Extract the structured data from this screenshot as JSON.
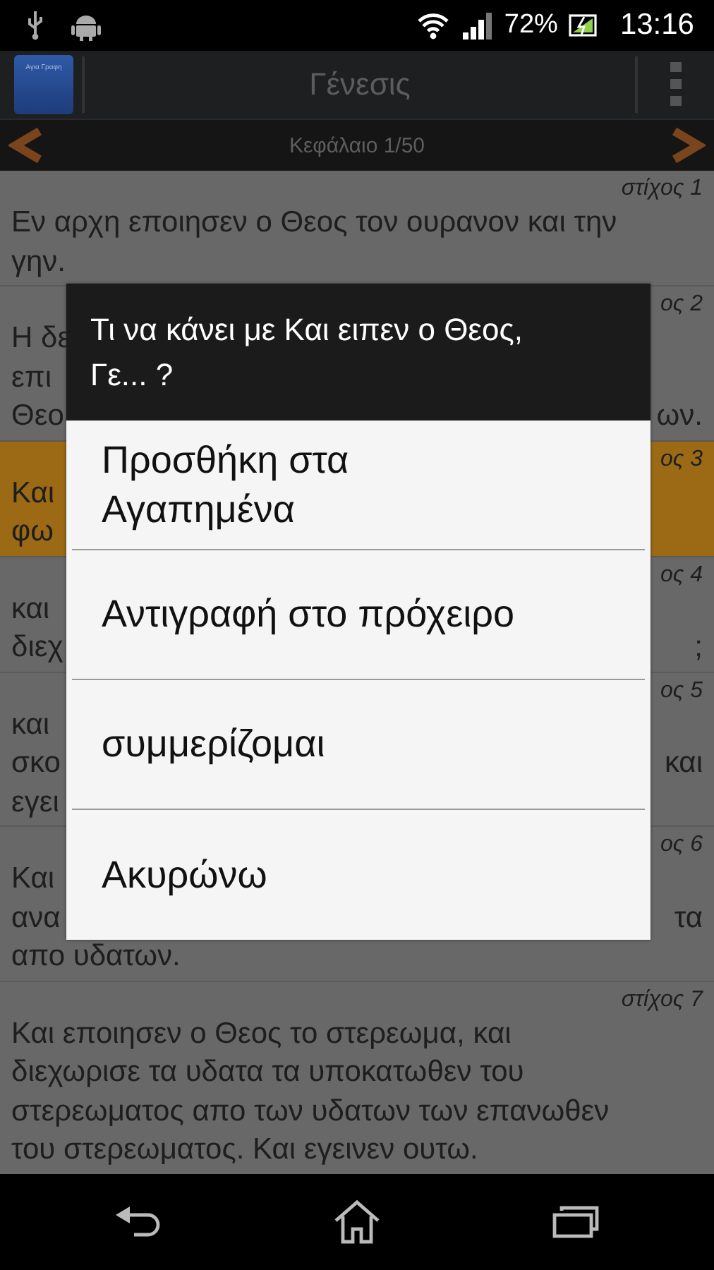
{
  "status_bar": {
    "battery": "72%",
    "time": "13:16"
  },
  "action_bar": {
    "app_icon_text": "Αγια Γραφη",
    "title": "Γένεσις"
  },
  "chapter_bar": {
    "label": "Κεφάλαιο 1/50"
  },
  "verses": [
    {
      "label": "στίχος 1",
      "selected": false,
      "lines": [
        {
          "left": "Εν αρχη εποιησεν ο Θεος τον ουρανον και την"
        },
        {
          "left": "γην."
        }
      ]
    },
    {
      "label": "ος 2",
      "selected": false,
      "lines": [
        {
          "left": "Η δε"
        },
        {
          "left": "επι"
        },
        {
          "left": "Θεο",
          "right": "ων."
        }
      ]
    },
    {
      "label": "ος 3",
      "selected": true,
      "lines": [
        {
          "left": "Και"
        },
        {
          "left": "φω"
        }
      ]
    },
    {
      "label": "ος 4",
      "selected": false,
      "lines": [
        {
          "left": "και"
        },
        {
          "left": "διεχ",
          "right": ";"
        }
      ]
    },
    {
      "label": "ος 5",
      "selected": false,
      "lines": [
        {
          "left": "και"
        },
        {
          "left": "σκο",
          "right": "και"
        },
        {
          "left": "εγει"
        }
      ]
    },
    {
      "label": "ος 6",
      "selected": false,
      "lines": [
        {
          "left": "Και"
        },
        {
          "left": "ανα",
          "right": "τα"
        },
        {
          "left": "απο υδατων."
        }
      ]
    },
    {
      "label": "στίχος 7",
      "selected": false,
      "lines": [
        {
          "left": "Και εποιησεν ο Θεος το στερεωμα, και"
        },
        {
          "left": "διεχωρισε τα υδατα τα υποκατωθεν του"
        },
        {
          "left": "στερεωματος απο των υδατων των επανωθεν"
        },
        {
          "left": "του στερεωματος. Και εγεινεν ουτω."
        }
      ]
    }
  ],
  "dialog": {
    "title": "Τι να κάνει με Και ειπεν ο Θεος,\nΓε... ?",
    "items": [
      "Προσθήκη στα\nΑγαπημένα",
      "Αντιγραφή στο πρόχειρο",
      "συμμερίζομαι",
      "Ακυρώνω"
    ]
  }
}
